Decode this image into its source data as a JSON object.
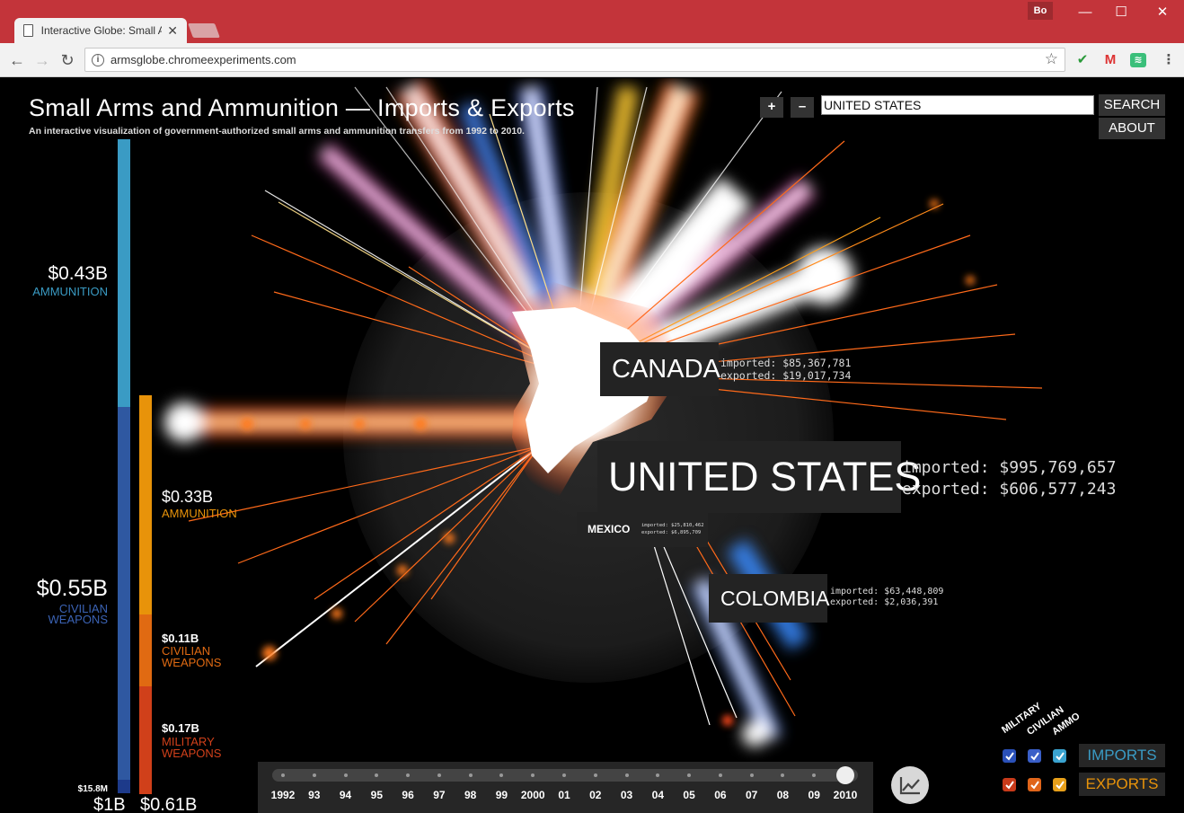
{
  "browser": {
    "tab_title": "Interactive Globe: Small Arms Imports & Exports",
    "profile": "Bo",
    "url": "armsglobe.chromeexperiments.com",
    "window_controls": {
      "minimize": "—",
      "maximize": "☐",
      "close": "✕"
    }
  },
  "app": {
    "title": "Small Arms and Ammunition — Imports & Exports",
    "subtitle": "An interactive visualization of government-authorized small arms and ammunition transfers from 1992 to 2010.",
    "zoom_in": "+",
    "zoom_out": "–",
    "search_value": "UNITED STATES",
    "search_button": "SEARCH",
    "about_button": "ABOUT"
  },
  "totals": {
    "imports_total": "$1B",
    "exports_total": "$0.61B",
    "imports_small": "$15.8M",
    "imports": [
      {
        "value": "$0.43B",
        "label": "AMMUNITION",
        "color": "#3a9bc4",
        "share": 0.41
      },
      {
        "value": "$0.55B",
        "label_line1": "CIVILIAN",
        "label_line2": "WEAPONS",
        "color": "#2f58a1",
        "share": 0.57
      },
      {
        "value": "",
        "label": "",
        "color": "#1d3a8a",
        "share": 0.02
      }
    ],
    "exports": [
      {
        "value": "$0.33B",
        "label": "AMMUNITION",
        "color": "#e8930a",
        "share": 0.55
      },
      {
        "value": "$0.11B",
        "label_line1": "CIVILIAN",
        "label_line2": "WEAPONS",
        "color": "#e06a12",
        "share": 0.18
      },
      {
        "value": "$0.17B",
        "label_line1": "MILITARY",
        "label_line2": "WEAPONS",
        "color": "#d0401a",
        "share": 0.27
      }
    ]
  },
  "countries": {
    "usa": {
      "name": "UNITED STATES",
      "imported": "imported: $995,769,657",
      "exported": "exported: $606,577,243"
    },
    "canada": {
      "name": "CANADA",
      "imported": "imported: $85,367,781",
      "exported": "exported: $19,017,734"
    },
    "mexico": {
      "name": "MEXICO",
      "imported": "imported: $25,810,462",
      "exported": "exported: $6,895,709"
    },
    "colombia": {
      "name": "COLOMBIA",
      "imported": "imported: $63,448,809",
      "exported": "exported: $2,036,391"
    }
  },
  "timeline": {
    "years": [
      "1992",
      "93",
      "94",
      "95",
      "96",
      "97",
      "98",
      "99",
      "2000",
      "01",
      "02",
      "03",
      "04",
      "05",
      "06",
      "07",
      "08",
      "09",
      "2010"
    ],
    "selected": "2010"
  },
  "legend": {
    "headers": [
      "MILITARY",
      "CIVILIAN",
      "AMMO"
    ],
    "imports_label": "IMPORTS",
    "exports_label": "EXPORTS",
    "imports_color": "#3a9bc4",
    "exports_color": "#e8930a"
  }
}
